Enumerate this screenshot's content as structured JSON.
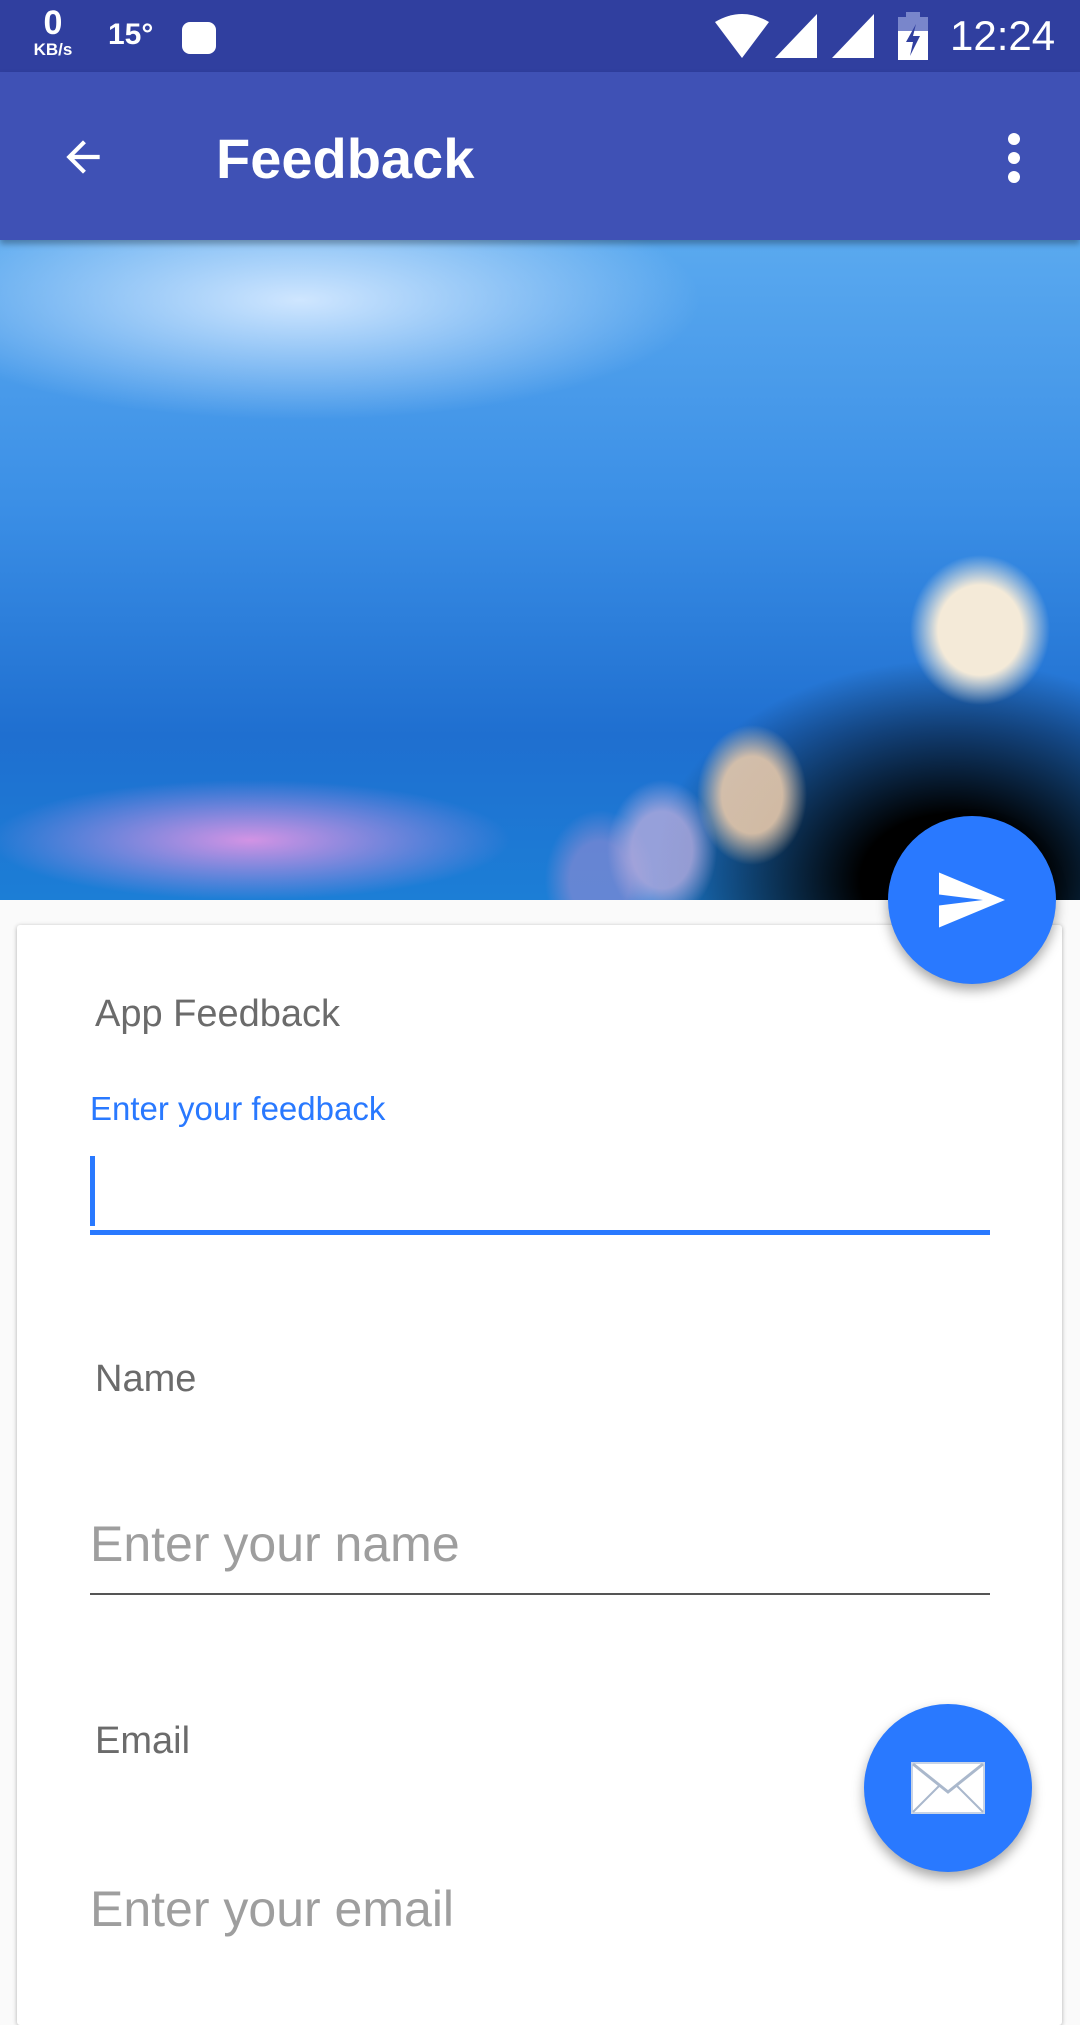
{
  "status_bar": {
    "net_speed": "0",
    "net_unit": "KB/s",
    "temperature": "15°",
    "time": "12:24"
  },
  "app_bar": {
    "title": "Feedback"
  },
  "form": {
    "feedback_label": "App Feedback",
    "feedback_hint": "Enter your feedback",
    "feedback_value": "",
    "name_label": "Name",
    "name_placeholder": "Enter your name",
    "email_label": "Email",
    "email_placeholder": "Enter your email"
  },
  "colors": {
    "primary": "#3f51b5",
    "primary_dark": "#303f9f",
    "accent": "#2979ff"
  }
}
